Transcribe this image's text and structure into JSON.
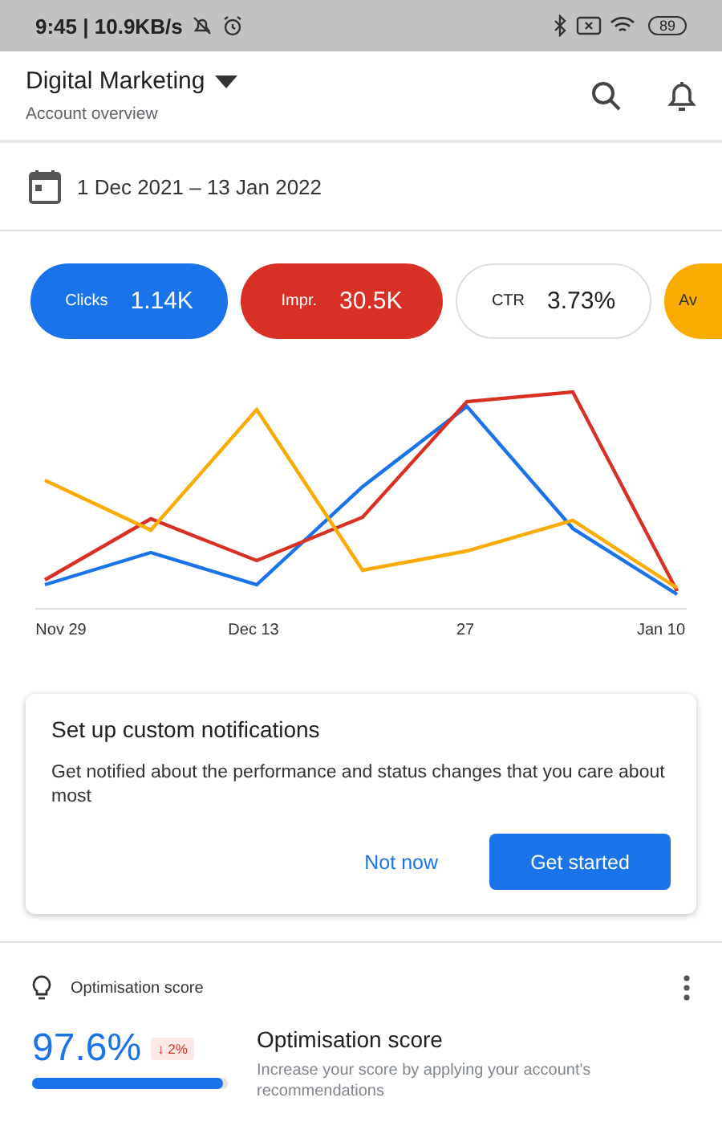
{
  "status_bar": {
    "time": "9:45 | 10.9KB/s",
    "battery": "89"
  },
  "header": {
    "title": "Digital Marketing",
    "subtitle": "Account overview"
  },
  "date_range": "1 Dec 2021 – 13 Jan 2022",
  "metrics": [
    {
      "label": "Clicks",
      "value": "1.14K",
      "selected": true,
      "color": "#1a73e8"
    },
    {
      "label": "Impr.",
      "value": "30.5K",
      "selected": true,
      "color": "#d93025"
    },
    {
      "label": "CTR",
      "value": "3.73%",
      "selected": false
    },
    {
      "label": "Av",
      "selected": true,
      "color": "#f9ab00"
    }
  ],
  "chart": {
    "x_labels": [
      "Nov 29",
      "Dec 13",
      "27",
      "Jan 10"
    ]
  },
  "notification_card": {
    "title": "Set up custom notifications",
    "text": "Get notified about the performance and status changes that you care about most",
    "buttons": [
      "Not now",
      "Get started"
    ]
  },
  "optimisation": {
    "header": "Optimisation score",
    "score": "97.6%",
    "change": "↓ 2%",
    "level": 0.976,
    "title": "Optimisation score",
    "text": "Increase your score by applying your account's recommendations"
  }
}
